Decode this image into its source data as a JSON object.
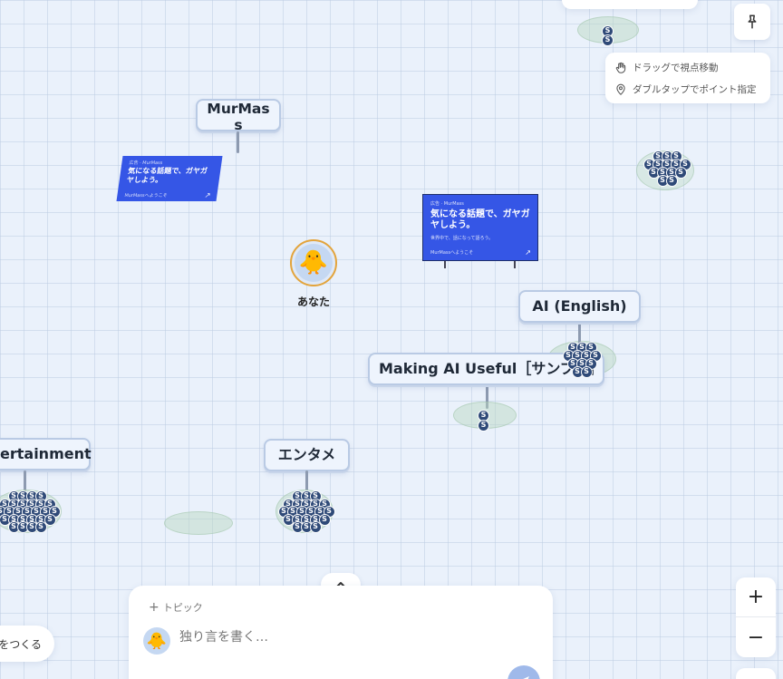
{
  "hints": {
    "drag": "ドラッグで視点移動",
    "double_tap": "ダブルタップでポイント指定"
  },
  "topics": {
    "murmass": "MurMas\ns",
    "ai_english": "AI (English)",
    "making_ai": "Making AI Useful［サンプル］",
    "entertainment": "ertainment",
    "entame": "エンタメ"
  },
  "billboards": {
    "left": {
      "small": "広告 · MurMass",
      "title": "気になる話題で、ガヤガヤしよう。",
      "foot": "MurMassへようこそ"
    },
    "center": {
      "small": "広告 · MurMass",
      "title": "気になる話題で、ガヤガヤしよう。",
      "sub": "世界中で、話になって語ろう。",
      "foot": "MurMassへようこそ"
    }
  },
  "avatar": {
    "label": "あなた",
    "emoji": "🐥"
  },
  "coin_symbol": "S",
  "composer": {
    "topic_button": "トピック",
    "placeholder": "独り言を書く…",
    "avatar_emoji": "🐥"
  },
  "create_button": "をつくる",
  "zoom": {
    "in": "+",
    "out": "−"
  },
  "icons": {
    "pin": "pin-icon",
    "hand": "hand-icon",
    "location": "location-pin-icon",
    "chevron": "chevron-up-icon",
    "send": "send-icon",
    "plus": "plus-icon"
  }
}
